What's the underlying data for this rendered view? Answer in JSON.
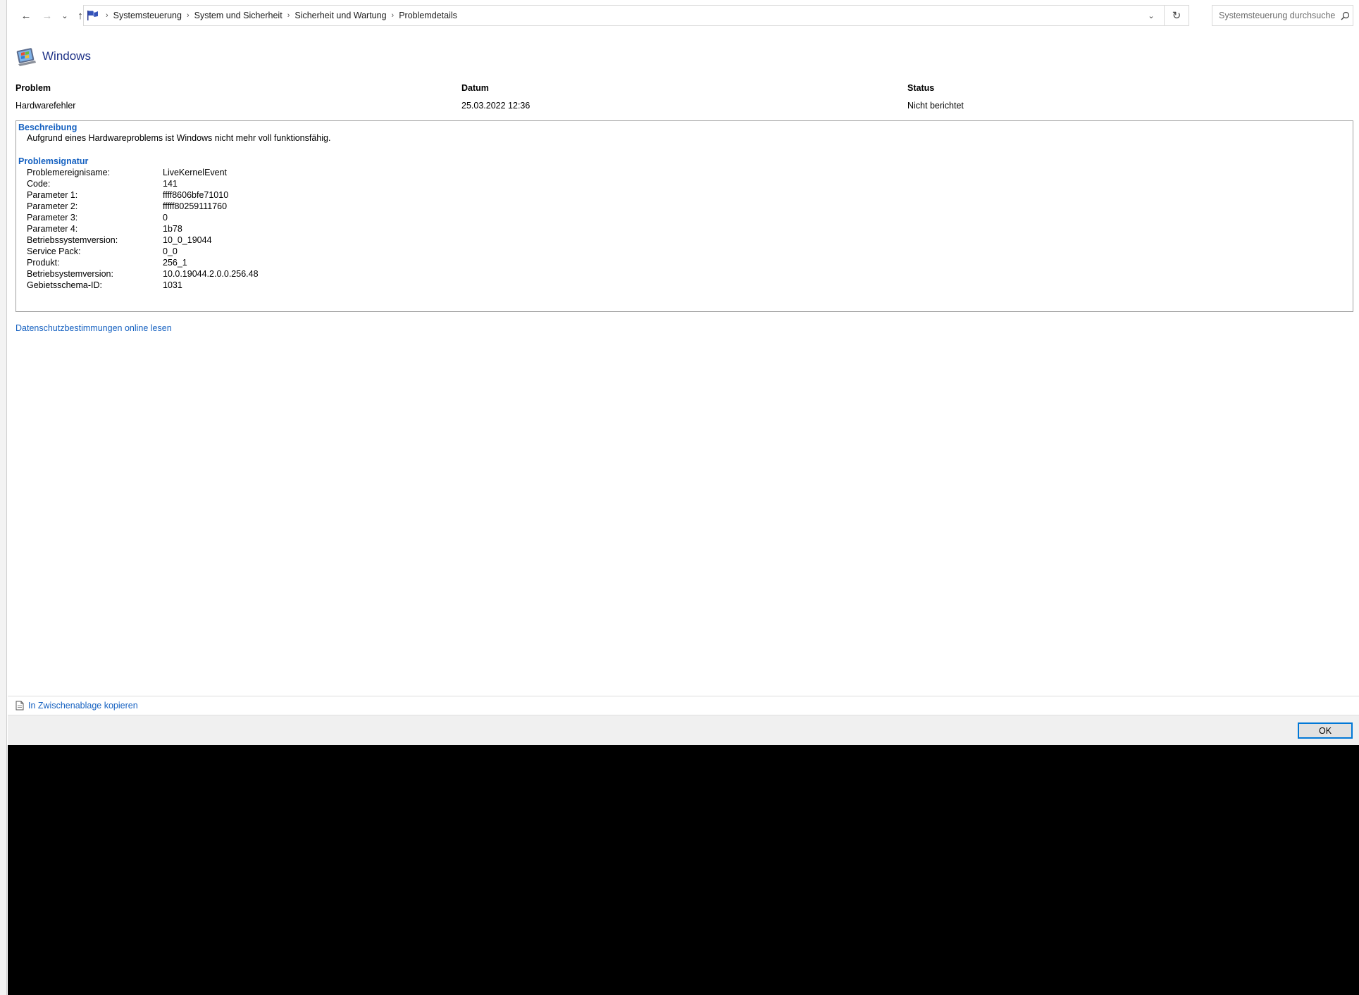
{
  "address_bar": {
    "breadcrumbs": [
      "Systemsteuerung",
      "System und Sicherheit",
      "Sicherheit und Wartung",
      "Problemdetails"
    ]
  },
  "search": {
    "placeholder": "Systemsteuerung durchsuchen"
  },
  "header": {
    "title": "Windows"
  },
  "summary": {
    "problem_label": "Problem",
    "problem_value": "Hardwarefehler",
    "date_label": "Datum",
    "date_value": "25.03.2022 12:36",
    "status_label": "Status",
    "status_value": "Nicht berichtet"
  },
  "description": {
    "title": "Beschreibung",
    "text": "Aufgrund eines Hardwareproblems ist Windows nicht mehr voll funktionsfähig."
  },
  "signature": {
    "title": "Problemsignatur",
    "rows": [
      {
        "label": "Problemereignisame:",
        "value": "LiveKernelEvent"
      },
      {
        "label": "Code:",
        "value": "141"
      },
      {
        "label": "Parameter 1:",
        "value": "ffff8606bfe71010"
      },
      {
        "label": "Parameter 2:",
        "value": "fffff80259111760"
      },
      {
        "label": "Parameter 3:",
        "value": "0"
      },
      {
        "label": "Parameter 4:",
        "value": "1b78"
      },
      {
        "label": "Betriebssystemversion:",
        "value": "10_0_19044"
      },
      {
        "label": "Service Pack:",
        "value": "0_0"
      },
      {
        "label": "Produkt:",
        "value": "256_1"
      },
      {
        "label": "Betriebsystemversion:",
        "value": "10.0.19044.2.0.0.256.48"
      },
      {
        "label": "Gebietsschema-ID:",
        "value": "1031"
      }
    ]
  },
  "links": {
    "privacy": "Datenschutzbestimmungen online lesen",
    "copy": "In Zwischenablage kopieren"
  },
  "footer": {
    "ok_label": "OK"
  },
  "colors": {
    "link": "#1561c1",
    "title": "#1e3287",
    "accent": "#0078d7"
  }
}
